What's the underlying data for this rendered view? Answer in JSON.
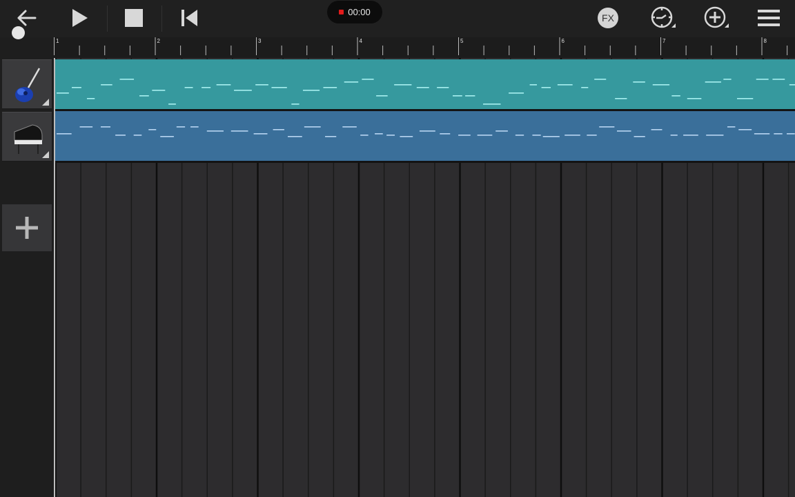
{
  "toolbar": {
    "icons": [
      "back-arrow-icon",
      "play-icon",
      "stop-icon",
      "rewind-to-start-icon",
      "fx-icon",
      "metronome-icon",
      "add-icon",
      "menu-icon"
    ],
    "fx_label": "FX",
    "recording_time": "00:00",
    "recording_indicator_color": "#e21b1b"
  },
  "ruler": {
    "bar_numbers": [
      "1",
      "2",
      "3",
      "4",
      "5",
      "6",
      "7",
      "8"
    ]
  },
  "tracks": [
    {
      "instrument": "guitar-icon",
      "region_color": "#36999e",
      "note_color": "#a8f0f0"
    },
    {
      "instrument": "grand-piano-icon",
      "region_color": "#3a6f9a",
      "note_color": "#b9d6f2"
    }
  ],
  "add_track": {
    "icon": "plus-icon"
  }
}
